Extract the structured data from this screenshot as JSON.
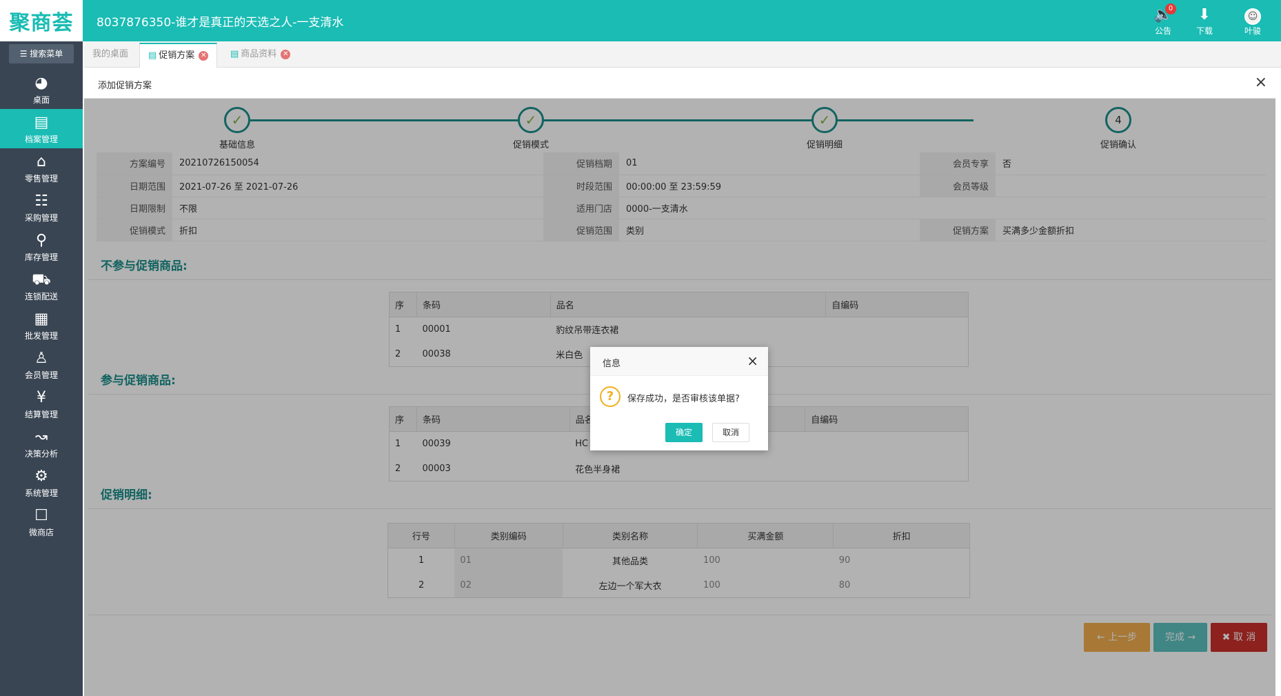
{
  "header": {
    "logo": "聚商荟",
    "title": "8037876350-谁才是真正的天选之人-一支清水",
    "notice_label": "公告",
    "notice_count": "0",
    "download_label": "下载",
    "user_name": "叶骏"
  },
  "sidebar": {
    "search_label": "搜索菜单",
    "items": [
      {
        "label": "桌面",
        "icon": "dashboard-icon"
      },
      {
        "label": "档案管理",
        "icon": "archive-icon"
      },
      {
        "label": "零售管理",
        "icon": "store-icon"
      },
      {
        "label": "采购管理",
        "icon": "cart-icon"
      },
      {
        "label": "库存管理",
        "icon": "inventory-search-icon"
      },
      {
        "label": "连锁配送",
        "icon": "truck-icon"
      },
      {
        "label": "批发管理",
        "icon": "wholesale-icon"
      },
      {
        "label": "会员管理",
        "icon": "member-icon"
      },
      {
        "label": "结算管理",
        "icon": "settlement-icon"
      },
      {
        "label": "决策分析",
        "icon": "chart-icon"
      },
      {
        "label": "系统管理",
        "icon": "gear-icon"
      },
      {
        "label": "微商店",
        "icon": "shop-bag-icon"
      }
    ],
    "active_index": 1
  },
  "tabs": [
    {
      "label": "我的桌面"
    },
    {
      "label": "促销方案"
    },
    {
      "label": "商品资料"
    }
  ],
  "panel": {
    "title": "添加促销方案"
  },
  "steps": [
    {
      "label": "基础信息",
      "num": ""
    },
    {
      "label": "促销模式",
      "num": ""
    },
    {
      "label": "促销明细",
      "num": ""
    },
    {
      "label": "促销确认",
      "num": "4"
    }
  ],
  "info": {
    "row1": {
      "l1": "方案编号",
      "v1": "20210726150054",
      "l2": "促销档期",
      "v2": "01",
      "l3": "会员专享",
      "v3": "否"
    },
    "row2": {
      "l1": "日期范围",
      "v1": "2021-07-26 至 2021-07-26",
      "l2": "时段范围",
      "v2": "00:00:00 至 23:59:59",
      "l3": "会员等级",
      "v3": ""
    },
    "row3": {
      "l1": "日期限制",
      "v1": "不限",
      "l2": "适用门店",
      "v2": "0000-一支清水",
      "l3": "",
      "v3": ""
    },
    "row4": {
      "l1": "促销模式",
      "v1": "折扣",
      "l2": "促销范围",
      "v2": "类别",
      "l3": "促销方案",
      "v3": "买满多少金额折扣"
    }
  },
  "excluded": {
    "title": "不参与促销商品:",
    "headers": {
      "seq": "序",
      "barcode": "条码",
      "name": "品名",
      "code": "自编码"
    },
    "rows": [
      {
        "seq": "1",
        "barcode": "00001",
        "name": "豹纹吊带连衣裙",
        "code": ""
      },
      {
        "seq": "2",
        "barcode": "00038",
        "name": "米白色",
        "code": ""
      }
    ]
  },
  "included": {
    "title": "参与促销商品:",
    "headers": {
      "seq": "序",
      "barcode": "条码",
      "name": "品名",
      "code": "自编码"
    },
    "rows": [
      {
        "seq": "1",
        "barcode": "00039",
        "name": "HC",
        "code": ""
      },
      {
        "seq": "2",
        "barcode": "00003",
        "name": "花色半身裙",
        "code": ""
      }
    ]
  },
  "detail": {
    "title": "促销明细:",
    "headers": {
      "row": "行号",
      "cat_code": "类别编码",
      "cat_name": "类别名称",
      "amount": "买满金额",
      "discount": "折扣"
    },
    "rows": [
      {
        "row": "1",
        "cat_code": "01",
        "cat_name": "其他品类",
        "amount": "100",
        "discount": "90"
      },
      {
        "row": "2",
        "cat_code": "02",
        "cat_name": "左边一个军大衣",
        "amount": "100",
        "discount": "80"
      }
    ]
  },
  "buttons": {
    "prev": "上一步",
    "finish": "完成",
    "cancel": "取 消"
  },
  "dialog": {
    "title": "信息",
    "message": "保存成功，是否审核该单据?",
    "ok": "确定",
    "cancel": "取消"
  },
  "colors": {
    "accent": "#1abcb4",
    "sidebar": "#394553",
    "prev_button": "#f0ad4e",
    "finish_button": "#5bc0be",
    "cancel_button": "#c9302c"
  }
}
